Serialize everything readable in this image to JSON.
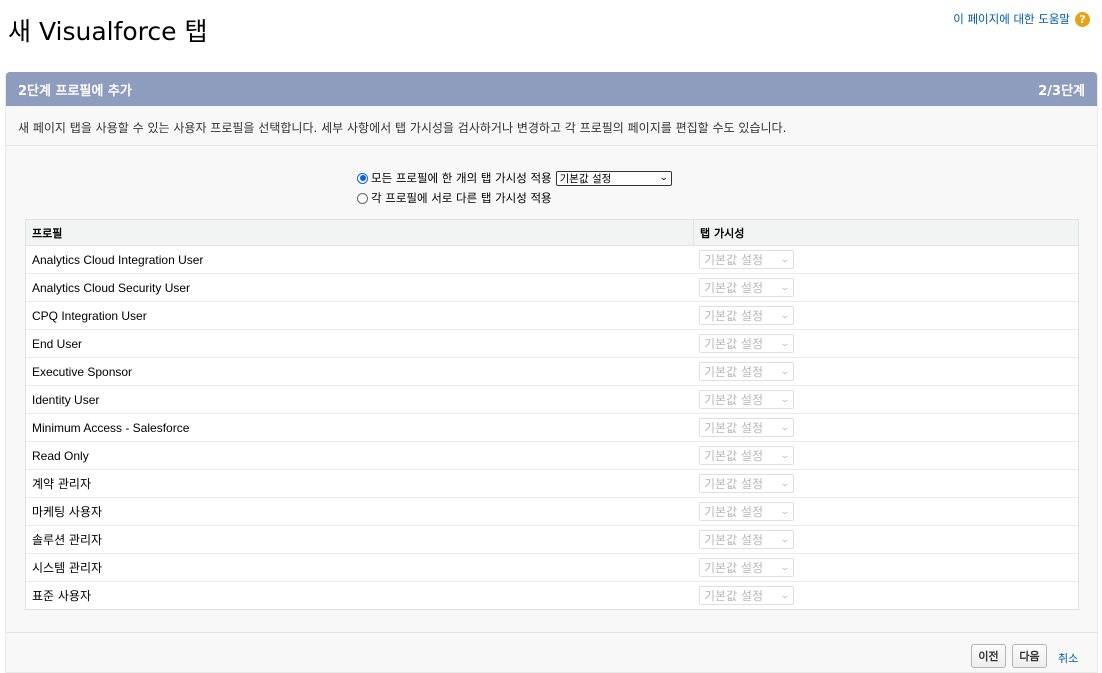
{
  "page": {
    "title": "새 Visualforce 탭",
    "help_link": "이 페이지에 대한 도움말",
    "help_icon_glyph": "?"
  },
  "panel": {
    "step_title": "2단계 프로필에 추가",
    "step_counter": "2/3단계",
    "description": "새 페이지 탭을 사용할 수 있는 사용자 프로필을 선택합니다. 세부 사항에서 탭 가시성을 검사하거나 변경하고 각 프로필의 페이지를 편집할 수도 있습니다."
  },
  "options": {
    "apply_all_label": "모든 프로필에 한 개의 탭 가시성 적용",
    "apply_all_selected": true,
    "apply_all_select_value": "기본값 설정",
    "apply_each_label": "각 프로필에 서로 다른 탭 가시성 적용",
    "apply_each_selected": false
  },
  "table": {
    "headers": [
      "프로필",
      "탭 가시성"
    ],
    "rows": [
      {
        "profile": "Analytics Cloud Integration User",
        "visibility": "기본값 설정"
      },
      {
        "profile": "Analytics Cloud Security User",
        "visibility": "기본값 설정"
      },
      {
        "profile": "CPQ Integration User",
        "visibility": "기본값 설정"
      },
      {
        "profile": "End User",
        "visibility": "기본값 설정"
      },
      {
        "profile": "Executive Sponsor",
        "visibility": "기본값 설정"
      },
      {
        "profile": "Identity User",
        "visibility": "기본값 설정"
      },
      {
        "profile": "Minimum Access - Salesforce",
        "visibility": "기본값 설정"
      },
      {
        "profile": "Read Only",
        "visibility": "기본값 설정"
      },
      {
        "profile": "계약 관리자",
        "visibility": "기본값 설정"
      },
      {
        "profile": "마케팅 사용자",
        "visibility": "기본값 설정"
      },
      {
        "profile": "솔루션 관리자",
        "visibility": "기본값 설정"
      },
      {
        "profile": "시스템 관리자",
        "visibility": "기본값 설정"
      },
      {
        "profile": "표준 사용자",
        "visibility": "기본값 설정"
      }
    ]
  },
  "footer": {
    "prev_label": "이전",
    "next_label": "다음",
    "cancel_label": "취소"
  },
  "colors": {
    "header_bar": "#8e9dbe",
    "link": "#015ba7",
    "help_icon": "#e8a317"
  },
  "icons": {
    "help": "help-icon",
    "select_arrow": "chevron-down-icon"
  }
}
